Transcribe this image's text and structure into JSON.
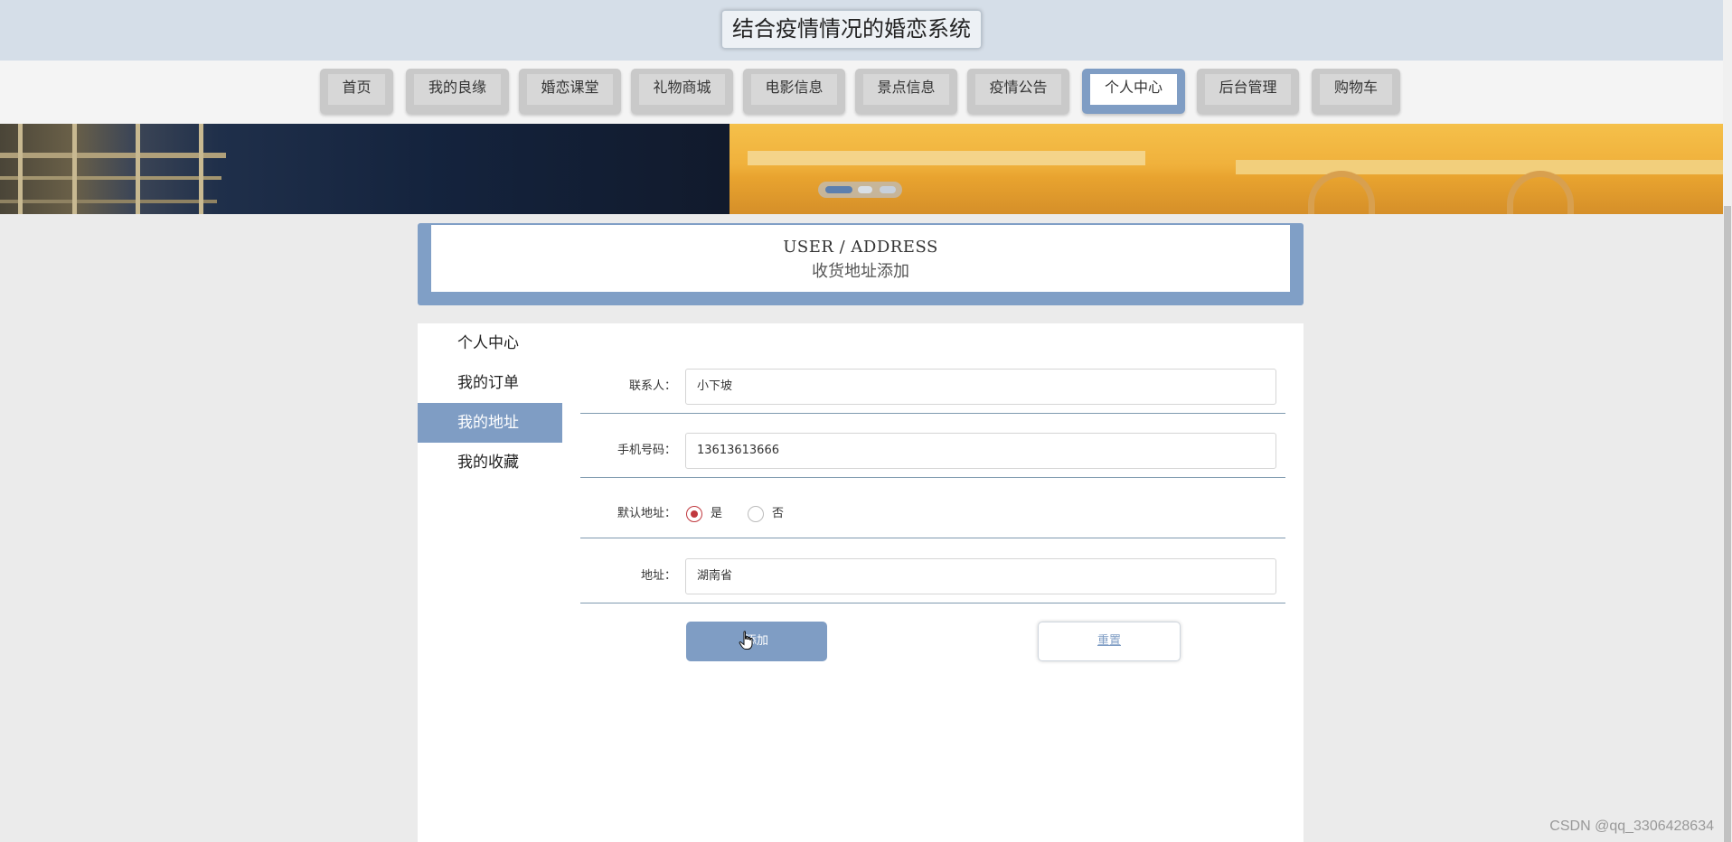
{
  "app": {
    "title": "结合疫情情况的婚恋系统"
  },
  "nav": {
    "items": [
      {
        "label": "首页"
      },
      {
        "label": "我的良缘"
      },
      {
        "label": "婚恋课堂"
      },
      {
        "label": "礼物商城"
      },
      {
        "label": "电影信息"
      },
      {
        "label": "景点信息"
      },
      {
        "label": "疫情公告"
      },
      {
        "label": "个人中心",
        "active": true
      },
      {
        "label": "后台管理"
      },
      {
        "label": "购物车"
      }
    ]
  },
  "banner": {
    "slide_count": 3,
    "active_slide": 1
  },
  "page_header": {
    "title_en": "USER / ADDRESS",
    "title_cn": "收货地址添加"
  },
  "sidebar": {
    "items": [
      {
        "label": "个人中心"
      },
      {
        "label": "我的订单"
      },
      {
        "label": "我的地址",
        "active": true
      },
      {
        "label": "我的收藏"
      }
    ]
  },
  "form": {
    "contact": {
      "label": "联系人：",
      "value": "小下坡"
    },
    "phone": {
      "label": "手机号码：",
      "value": "13613613666"
    },
    "default": {
      "label": "默认地址：",
      "options": [
        "是",
        "否"
      ],
      "selected": "是"
    },
    "address": {
      "label": "地址：",
      "value": "湖南省"
    },
    "add_button": "添加",
    "reset_button": "重置"
  },
  "watermark": "CSDN @qq_3306428634",
  "colors": {
    "accent": "#7f9dc4",
    "header_bg": "#d5dee8",
    "radio_checked": "#c0383e"
  }
}
